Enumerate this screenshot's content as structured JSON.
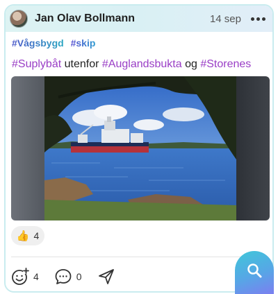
{
  "post": {
    "author": "Jan Olav Bollmann",
    "date": "14 sep",
    "tags": [
      "#Vågsbygd",
      "#skip"
    ],
    "text": {
      "tag1": "#Suplybåt",
      "word1": "utenfor",
      "tag2": "#Auglandsbukta",
      "word2": "og",
      "tag3": "#Storenes"
    }
  },
  "reactions": {
    "emoji": "👍",
    "count": "4"
  },
  "actions": {
    "react_count": "4",
    "comment_count": "0"
  },
  "icons": {
    "more": "more-dots-icon",
    "react": "add-reaction-icon",
    "comment": "comment-icon",
    "share": "send-icon",
    "search": "search-icon"
  },
  "colors": {
    "hashtag": "#9a3ec6",
    "header_bg": "#ddf3f3",
    "card_border": "#c9ecef",
    "fab": "#57a6e6"
  }
}
